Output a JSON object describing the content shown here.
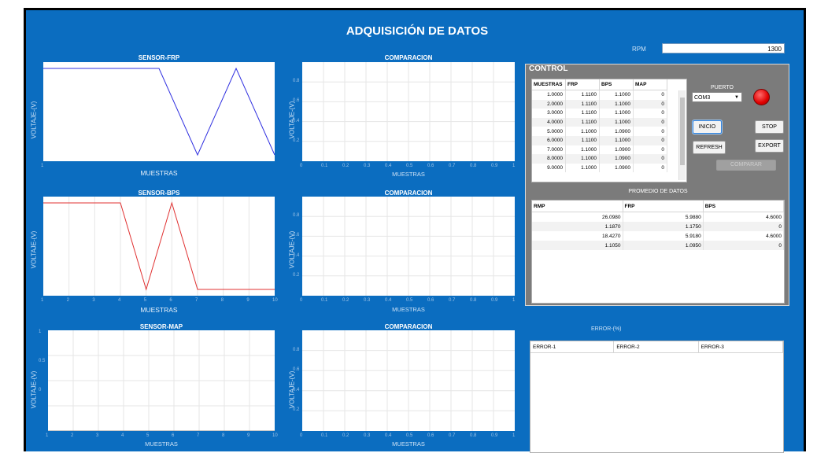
{
  "app": {
    "title": "ADQUISICIÓN DE DATOS"
  },
  "rpm": {
    "label": "RPM",
    "value": "1300"
  },
  "plots": {
    "frp": {
      "title": "SENSOR-FRP",
      "ylabel": "VOLTAJE-(V)",
      "xlabel": "MUESTRAS",
      "xticks": [
        "1"
      ],
      "yticks": []
    },
    "bps": {
      "title": "SENSOR-BPS",
      "ylabel": "VOLTAJE-(V)",
      "xlabel": "MUESTRAS",
      "xticks": [
        "1",
        "2",
        "3",
        "4",
        "5",
        "6",
        "7",
        "8",
        "9",
        "10"
      ],
      "yticks": []
    },
    "map": {
      "title": "SENSOR-MAP",
      "ylabel": "VOLTAJE-(V)",
      "xlabel": "MUESTRAS",
      "xticks": [
        "1",
        "2",
        "3",
        "4",
        "5",
        "6",
        "7",
        "8",
        "9",
        "10"
      ],
      "yticks": [
        "1",
        "0.5",
        "0"
      ]
    },
    "comp1": {
      "title": "COMPARACION",
      "ylabel": "VOLTAJE-(V)",
      "xlabel": "MUESTRAS",
      "xticks": [
        "0",
        "0.1",
        "0.2",
        "0.3",
        "0.4",
        "0.5",
        "0.6",
        "0.7",
        "0.8",
        "0.9",
        "1"
      ],
      "yticks": [
        "0.8",
        "0.6",
        "0.4",
        "0.2"
      ]
    },
    "comp2": {
      "title": "COMPARACION",
      "ylabel": "VOLTAJE-(V)",
      "xlabel": "MUESTRAS",
      "xticks": [
        "0",
        "0.1",
        "0.2",
        "0.3",
        "0.4",
        "0.5",
        "0.6",
        "0.7",
        "0.8",
        "0.9",
        "1"
      ],
      "yticks": [
        "0.8",
        "0.6",
        "0.4",
        "0.2"
      ]
    },
    "comp3": {
      "title": "COMPARACION",
      "ylabel": "VOLTAJE-(V)",
      "xlabel": "MUESTRAS",
      "xticks": [
        "0",
        "0.1",
        "0.2",
        "0.3",
        "0.4",
        "0.5",
        "0.6",
        "0.7",
        "0.8",
        "0.9",
        "1"
      ],
      "yticks": [
        "0.8",
        "0.6",
        "0.4",
        "0.2"
      ]
    }
  },
  "control": {
    "title": "CONTROL",
    "table": {
      "headers": [
        "MUESTRAS",
        "FRP",
        "BPS",
        "MAP"
      ],
      "rows": [
        [
          "1.0000",
          "1.1100",
          "1.1000",
          "0"
        ],
        [
          "2.0000",
          "1.1100",
          "1.1000",
          "0"
        ],
        [
          "3.0000",
          "1.1100",
          "1.1000",
          "0"
        ],
        [
          "4.0000",
          "1.1100",
          "1.1000",
          "0"
        ],
        [
          "5.0000",
          "1.1000",
          "1.0900",
          "0"
        ],
        [
          "6.0000",
          "1.1100",
          "1.1000",
          "0"
        ],
        [
          "7.0000",
          "1.1000",
          "1.0900",
          "0"
        ],
        [
          "8.0000",
          "1.1000",
          "1.0900",
          "0"
        ],
        [
          "9.0000",
          "1.1000",
          "1.0900",
          "0"
        ]
      ]
    },
    "puerto": {
      "label": "PUERTO",
      "selected": "COM3"
    },
    "buttons": {
      "inicio": "INICIO",
      "stop": "STOP",
      "refresh": "REFRESH",
      "export": "EXPORT",
      "comparar": "COMPARAR"
    },
    "promedio": {
      "title": "PROMEDIO DE DATOS",
      "headers": [
        "RMP",
        "FRP",
        "BPS"
      ],
      "rows": [
        [
          "26.0980",
          "5.9880",
          "4.6000"
        ],
        [
          "1.1870",
          "1.1750",
          "0"
        ],
        [
          "18.4270",
          "5.9180",
          "4.6000"
        ],
        [
          "1.1050",
          "1.0950",
          "0"
        ]
      ]
    }
  },
  "error": {
    "title": "ERROR-(%)",
    "headers": [
      "ERROR-1",
      "ERROR-2",
      "ERROR-3"
    ]
  },
  "chart_data": [
    {
      "type": "line",
      "title": "SENSOR-FRP",
      "xlabel": "MUESTRAS",
      "ylabel": "VOLTAJE-(V)",
      "series": [
        {
          "color": "#3030e0",
          "x": [
            1,
            2,
            3,
            4,
            5,
            6,
            7
          ],
          "y": [
            1.11,
            1.11,
            1.11,
            1.11,
            1.1,
            1.11,
            1.1
          ]
        }
      ]
    },
    {
      "type": "line",
      "title": "SENSOR-BPS",
      "xlabel": "MUESTRAS",
      "ylabel": "VOLTAJE-(V)",
      "xlim": [
        1,
        10
      ],
      "series": [
        {
          "color": "#e03030",
          "x": [
            1,
            2,
            3,
            4,
            5,
            6,
            7,
            8,
            9,
            10
          ],
          "y": [
            1.1,
            1.1,
            1.1,
            1.1,
            1.09,
            1.1,
            1.09,
            1.09,
            1.09,
            1.09
          ]
        }
      ]
    },
    {
      "type": "line",
      "title": "SENSOR-MAP",
      "xlabel": "MUESTRAS",
      "ylabel": "VOLTAJE-(V)",
      "xlim": [
        1,
        10
      ],
      "ylim": [
        0,
        1
      ],
      "series": [
        {
          "color": "#909090",
          "x": [
            1,
            2,
            3,
            4,
            5,
            6,
            7,
            8,
            9,
            10
          ],
          "y": [
            0,
            0,
            0,
            0,
            0,
            0,
            0,
            0,
            0,
            0
          ]
        }
      ]
    },
    {
      "type": "line",
      "title": "COMPARACION",
      "xlabel": "MUESTRAS",
      "ylabel": "VOLTAJE-(V)",
      "xlim": [
        0,
        1
      ],
      "ylim": [
        0,
        1
      ],
      "series": []
    },
    {
      "type": "line",
      "title": "COMPARACION",
      "xlabel": "MUESTRAS",
      "ylabel": "VOLTAJE-(V)",
      "xlim": [
        0,
        1
      ],
      "ylim": [
        0,
        1
      ],
      "series": []
    },
    {
      "type": "line",
      "title": "COMPARACION",
      "xlabel": "MUESTRAS",
      "ylabel": "VOLTAJE-(V)",
      "xlim": [
        0,
        1
      ],
      "ylim": [
        0,
        1
      ],
      "series": []
    }
  ]
}
